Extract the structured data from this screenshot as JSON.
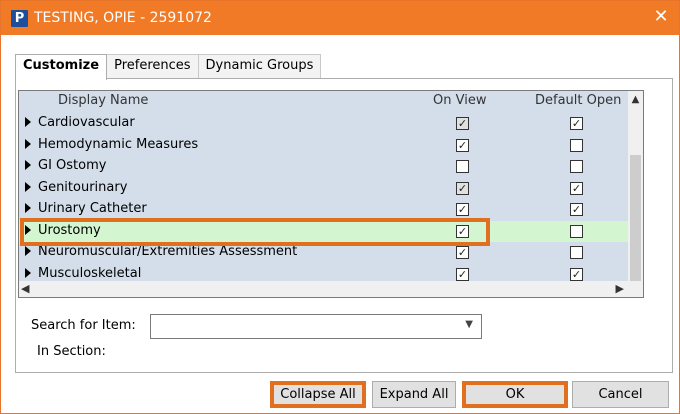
{
  "window": {
    "title": "TESTING, OPIE - 2591072",
    "app_icon": "P",
    "close": "✕"
  },
  "tabs": [
    {
      "label": "Customize",
      "active": true
    },
    {
      "label": "Preferences",
      "active": false
    },
    {
      "label": "Dynamic Groups",
      "active": false
    }
  ],
  "grid": {
    "headers": {
      "display_name": "Display Name",
      "on_view": "On View",
      "default_open": "Default Open"
    },
    "rows": [
      {
        "label": "Cardiovascular",
        "on_view": true,
        "on_view_gray": true,
        "default_open": true
      },
      {
        "label": "Hemodynamic Measures",
        "on_view": true,
        "on_view_gray": false,
        "default_open": false
      },
      {
        "label": "GI Ostomy",
        "on_view": false,
        "on_view_gray": false,
        "default_open": false
      },
      {
        "label": "Genitourinary",
        "on_view": true,
        "on_view_gray": true,
        "default_open": true
      },
      {
        "label": "Urinary Catheter",
        "on_view": true,
        "on_view_gray": false,
        "default_open": true
      },
      {
        "label": "Urostomy",
        "on_view": true,
        "on_view_gray": false,
        "default_open": false,
        "highlighted": true
      },
      {
        "label": "Neuromuscular/Extremities Assessment",
        "on_view": true,
        "on_view_gray": false,
        "default_open": false
      },
      {
        "label": "Musculoskeletal",
        "on_view": true,
        "on_view_gray": false,
        "default_open": true
      }
    ]
  },
  "search": {
    "label": "Search for Item:",
    "value": "",
    "section_label": "In Section:"
  },
  "buttons": {
    "collapse_all": "Collapse All",
    "expand_all": "Expand All",
    "ok": "OK",
    "cancel": "Cancel"
  },
  "colors": {
    "titlebar": "#f07a26",
    "highlight_border": "#e0701f",
    "grid_bg": "#d3deea",
    "row_highlight": "#d3f5d0"
  }
}
